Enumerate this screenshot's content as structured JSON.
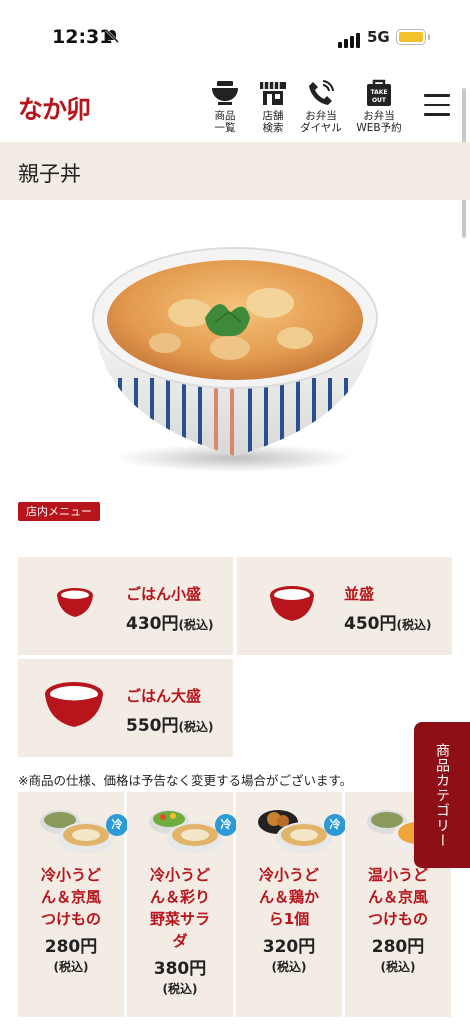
{
  "status_bar": {
    "time": "12:31",
    "network": "5G"
  },
  "header": {
    "logo": "なか卯",
    "nav": [
      {
        "label_line1": "商品",
        "label_line2": "一覧",
        "icon": "bowl-icon"
      },
      {
        "label_line1": "店舗",
        "label_line2": "検索",
        "icon": "store-icon"
      },
      {
        "label_line1": "お弁当",
        "label_line2": "ダイヤル",
        "icon": "phone-icon"
      },
      {
        "label_line1": "お弁当",
        "label_line2": "WEB予約",
        "icon": "takeout-bag-icon",
        "bag_text_1": "TAKE",
        "bag_text_2": "OUT"
      }
    ]
  },
  "page_title": "親子丼",
  "menu_badge": "店内メニュー",
  "sizes": [
    {
      "name": "ごはん小盛",
      "price": "430円",
      "tax": "(税込)"
    },
    {
      "name": "並盛",
      "price": "450円",
      "tax": "(税込)"
    },
    {
      "name": "ごはん大盛",
      "price": "550円",
      "tax": "(税込)"
    }
  ],
  "notice": "※商品の仕様、価格は予告なく変更する場合がございます。",
  "cards": [
    {
      "name_lines": [
        "冷小うど",
        "ん＆京風",
        "つけもの"
      ],
      "price": "280円",
      "tax": "(税込)",
      "badge": "冷"
    },
    {
      "name_lines": [
        "冷小うど",
        "ん＆彩り",
        "野菜サラ",
        "ダ"
      ],
      "price": "380円",
      "tax": "(税込)",
      "badge": "冷"
    },
    {
      "name_lines": [
        "冷小うど",
        "ん＆鶏か",
        "ら1個"
      ],
      "price": "320円",
      "tax": "(税込)",
      "badge": "冷"
    },
    {
      "name_lines": [
        "温小うど",
        "ん＆京風",
        "つけもの"
      ],
      "price": "280円",
      "tax": "(税込)",
      "badge": ""
    }
  ],
  "category_tab": "商品カテゴリー",
  "colors": {
    "brand_red": "#b8141b",
    "beige": "#f2ece4",
    "cold_blue": "#2c9ad6",
    "tab_dark_red": "#8e1016"
  }
}
